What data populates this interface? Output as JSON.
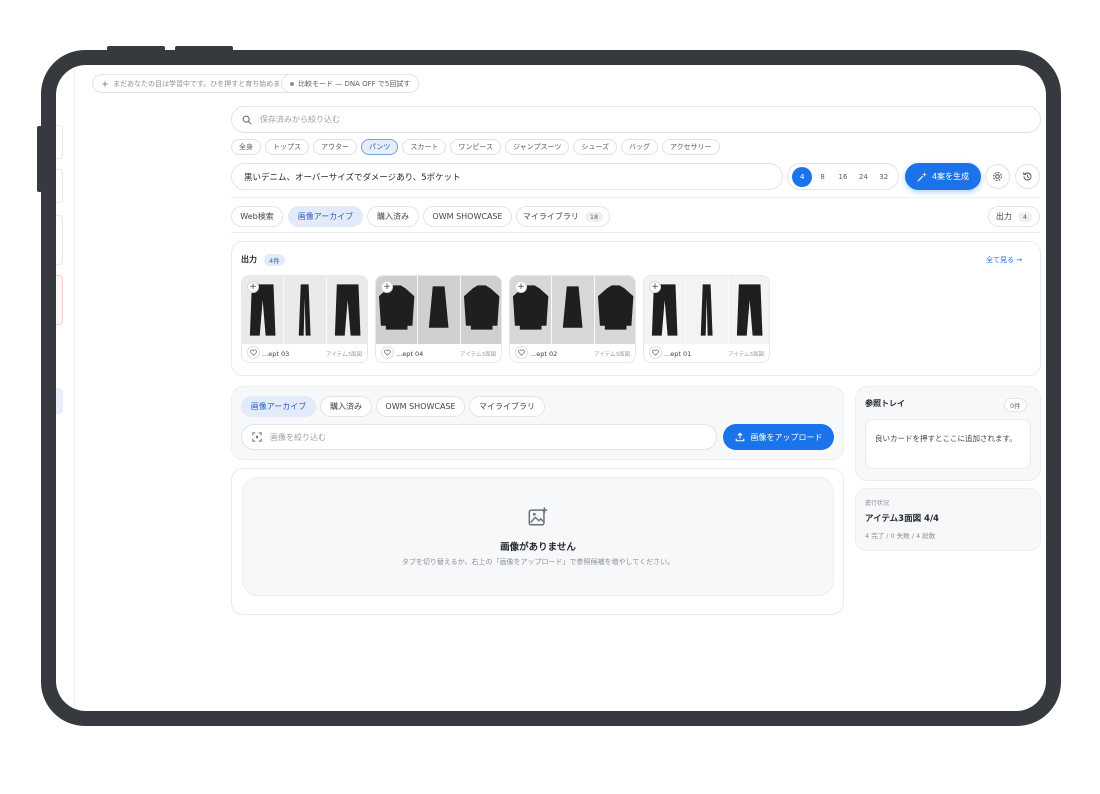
{
  "banner": {
    "learning_notice": "まだあなたの目は学習中です。ひを押すと育ち始めます",
    "mode_notice": "比較モード — DNA OFF で5回試す"
  },
  "search": {
    "placeholder": "保存済みから絞り込む"
  },
  "categories": [
    {
      "label": "全身",
      "active": false
    },
    {
      "label": "トップス",
      "active": false
    },
    {
      "label": "アウター",
      "active": false
    },
    {
      "label": "パンツ",
      "active": true
    },
    {
      "label": "スカート",
      "active": false
    },
    {
      "label": "ワンピース",
      "active": false
    },
    {
      "label": "ジャンプスーツ",
      "active": false
    },
    {
      "label": "シューズ",
      "active": false
    },
    {
      "label": "バッグ",
      "active": false
    },
    {
      "label": "アクセサリー",
      "active": false
    }
  ],
  "prompt": {
    "value": "黒いデニム、オーバーサイズでダメージあり、5ポケット"
  },
  "count_options": [
    {
      "label": "4",
      "active": true
    },
    {
      "label": "8",
      "active": false
    },
    {
      "label": "16",
      "active": false
    },
    {
      "label": "24",
      "active": false
    },
    {
      "label": "32",
      "active": false
    }
  ],
  "generate_label": "4案を生成",
  "source_tabs": {
    "web": "Web検索",
    "archive": "画像アーカイブ",
    "purchased": "購入済み",
    "showcase": "OWM SHOWCASE",
    "library": "マイライブラリ",
    "library_count": "18",
    "output": "出力",
    "output_count": "4"
  },
  "output_panel": {
    "title": "出力",
    "count": "4件",
    "see_all": "全て見る →",
    "cards": [
      {
        "name": "...ept 03",
        "meta": "アイテム3面図",
        "kind": "pants",
        "tone": "#e9eaeb"
      },
      {
        "name": "...ept 04",
        "meta": "アイテム3面図",
        "kind": "jacket",
        "tone": "#cfd0d1"
      },
      {
        "name": "...ept 02",
        "meta": "アイテム3面図",
        "kind": "jacket",
        "tone": "#d6d7d8"
      },
      {
        "name": "...ept 01",
        "meta": "アイテム3面図",
        "kind": "pants",
        "tone": "#f2f3f4"
      }
    ]
  },
  "ref_tabs": {
    "archive": "画像アーカイブ",
    "purchased": "購入済み",
    "showcase": "OWM SHOWCASE",
    "library": "マイライブラリ"
  },
  "image_filter": {
    "placeholder": "画像を絞り込む"
  },
  "upload_label": "画像をアップロード",
  "empty_state": {
    "title": "画像がありません",
    "message": "タブを切り替えるか、右上の「画像をアップロード」で参照候補を増やしてください。"
  },
  "ref_tray": {
    "title": "参照トレイ",
    "count": "0件",
    "hint": "良いカードを押すとここに追加されます。"
  },
  "progress": {
    "label": "進行状況",
    "title": "アイテム3面図 4/4",
    "summary": "4 完了 / 0 失敗 / 4 総数"
  },
  "colors": {
    "accent": "#1a73e8",
    "frame": "#36393d"
  }
}
